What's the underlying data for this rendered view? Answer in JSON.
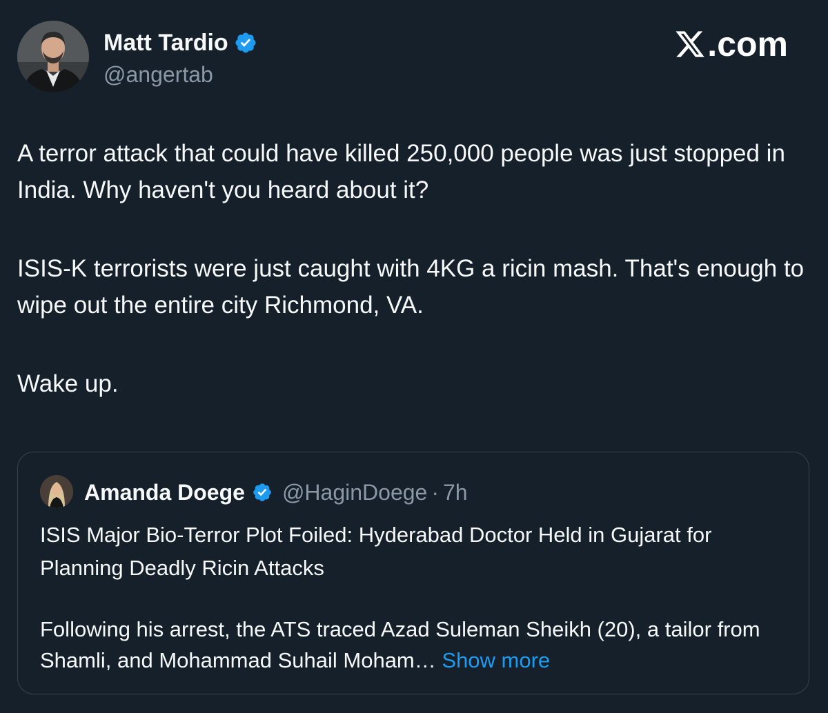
{
  "brand": {
    "text": ".com",
    "logo_icon": "x-logo-icon"
  },
  "author": {
    "name": "Matt Tardio",
    "handle": "@angertab",
    "verified": true,
    "verified_color": "#1d9bf0"
  },
  "tweet": {
    "paragraphs": [
      "A terror attack that could have killed 250,000 people was just stopped in India. Why haven't you heard about it?",
      "ISIS-K terrorists were just caught with 4KG a ricin mash. That's enough to wipe out the entire city Richmond, VA.",
      "Wake up."
    ]
  },
  "quote": {
    "name": "Amanda Doege",
    "handle": "@HaginDoege",
    "separator": "·",
    "time": "7h",
    "verified": true,
    "title": "ISIS Major Bio-Terror Plot Foiled: Hyderabad Doctor Held in Gujarat for Planning Deadly Ricin Attacks",
    "body": "Following his arrest, the ATS traced Azad Suleman Sheikh (20), a tailor from Shamli, and Mohammad Suhail Moham…",
    "show_more": "Show more"
  },
  "colors": {
    "background": "#15202b",
    "text": "#f7f9f9",
    "secondary": "#8b98a5",
    "link": "#1d9bf0",
    "border": "#38444d"
  }
}
